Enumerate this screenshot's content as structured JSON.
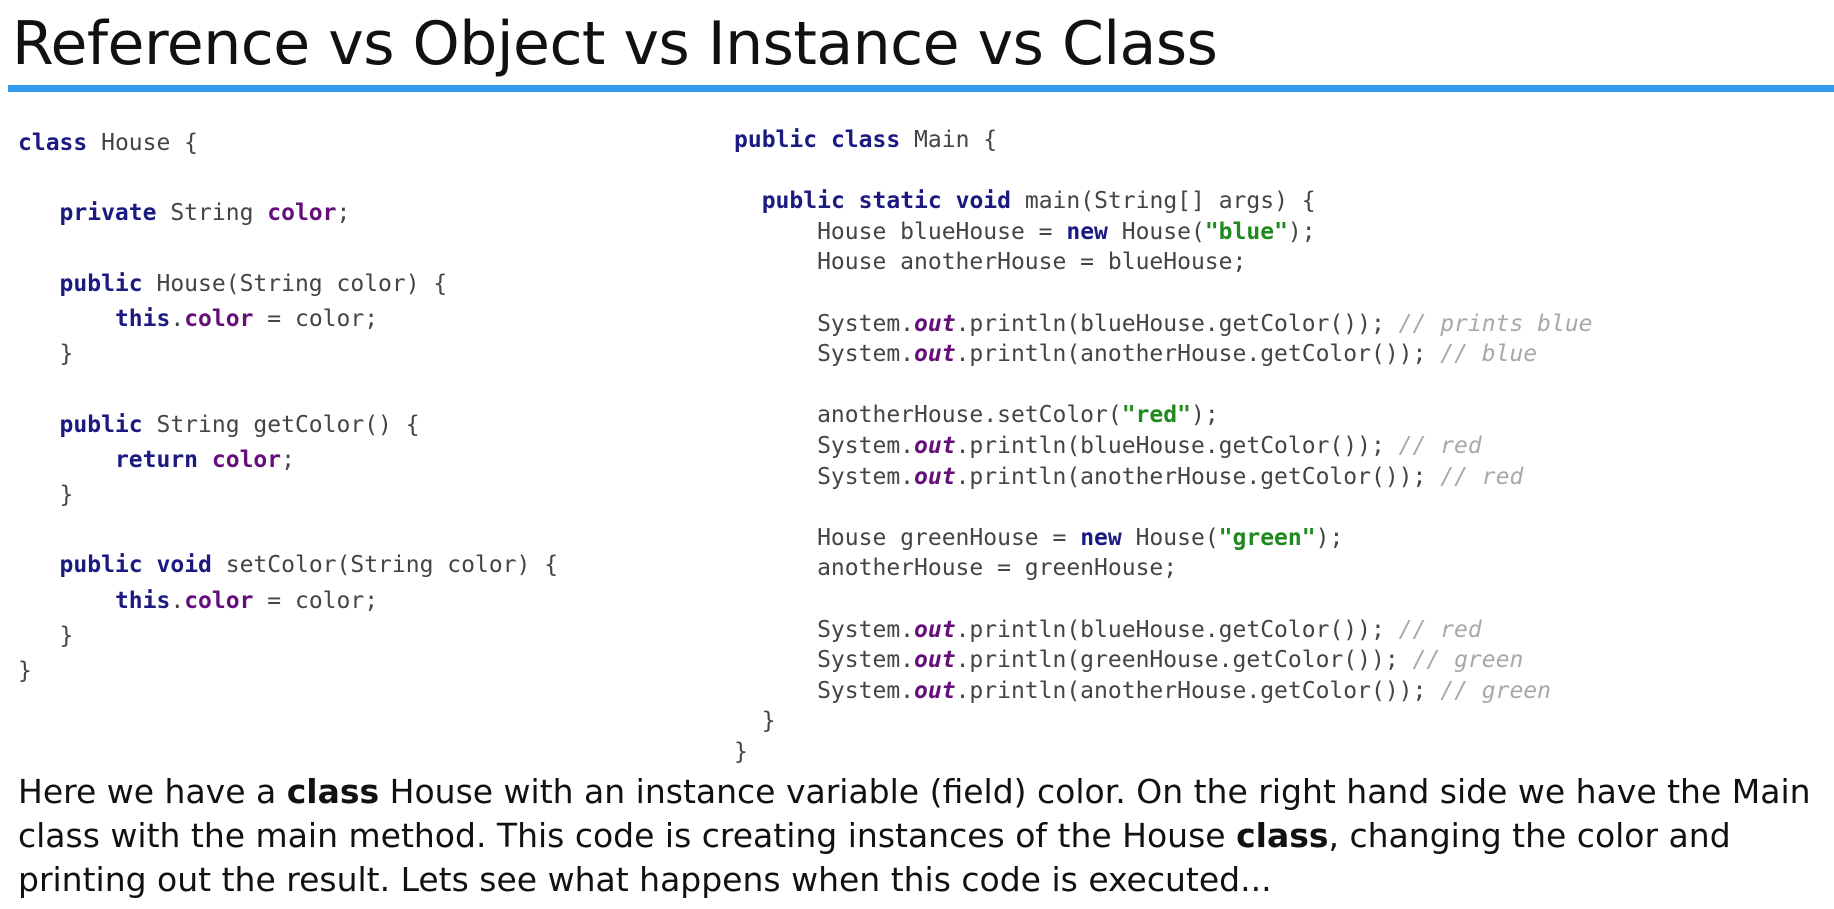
{
  "title": "Reference vs Object vs Instance vs Class",
  "left_code": [
    [
      [
        "kw",
        "class"
      ],
      [
        "pl",
        " House {"
      ]
    ],
    [],
    [
      [
        "pl",
        "   "
      ],
      [
        "kw",
        "private"
      ],
      [
        "pl",
        " String "
      ],
      [
        "fld",
        "color"
      ],
      [
        "pl",
        ";"
      ]
    ],
    [],
    [
      [
        "pl",
        "   "
      ],
      [
        "kw",
        "public"
      ],
      [
        "pl",
        " House(String color) {"
      ]
    ],
    [
      [
        "pl",
        "       "
      ],
      [
        "kw",
        "this"
      ],
      [
        "pl",
        "."
      ],
      [
        "fld",
        "color"
      ],
      [
        "pl",
        " = color;"
      ]
    ],
    [
      [
        "pl",
        "   }"
      ]
    ],
    [],
    [
      [
        "pl",
        "   "
      ],
      [
        "kw",
        "public"
      ],
      [
        "pl",
        " String getColor() {"
      ]
    ],
    [
      [
        "pl",
        "       "
      ],
      [
        "kw",
        "return"
      ],
      [
        "pl",
        " "
      ],
      [
        "fld",
        "color"
      ],
      [
        "pl",
        ";"
      ]
    ],
    [
      [
        "pl",
        "   }"
      ]
    ],
    [],
    [
      [
        "pl",
        "   "
      ],
      [
        "kw",
        "public"
      ],
      [
        "pl",
        " "
      ],
      [
        "kw",
        "void"
      ],
      [
        "pl",
        " setColor(String color) {"
      ]
    ],
    [
      [
        "pl",
        "       "
      ],
      [
        "kw",
        "this"
      ],
      [
        "pl",
        "."
      ],
      [
        "fld",
        "color"
      ],
      [
        "pl",
        " = color;"
      ]
    ],
    [
      [
        "pl",
        "   }"
      ]
    ],
    [
      [
        "pl",
        "}"
      ]
    ]
  ],
  "right_code": [
    [
      [
        "kw",
        "public"
      ],
      [
        "pl",
        " "
      ],
      [
        "kw",
        "class"
      ],
      [
        "pl",
        " Main {"
      ]
    ],
    [],
    [
      [
        "pl",
        "  "
      ],
      [
        "kw",
        "public"
      ],
      [
        "pl",
        " "
      ],
      [
        "kw",
        "static"
      ],
      [
        "pl",
        " "
      ],
      [
        "kw",
        "void"
      ],
      [
        "pl",
        " main(String[] args) {"
      ]
    ],
    [
      [
        "pl",
        "      House blueHouse = "
      ],
      [
        "kw",
        "new"
      ],
      [
        "pl",
        " House("
      ],
      [
        "str",
        "\"blue\""
      ],
      [
        "pl",
        ");"
      ]
    ],
    [
      [
        "pl",
        "      House anotherHouse = blueHouse;"
      ]
    ],
    [],
    [
      [
        "pl",
        "      System."
      ],
      [
        "out",
        "out"
      ],
      [
        "pl",
        ".println(blueHouse.getColor()); "
      ],
      [
        "cmt",
        "// prints blue"
      ]
    ],
    [
      [
        "pl",
        "      System."
      ],
      [
        "out",
        "out"
      ],
      [
        "pl",
        ".println(anotherHouse.getColor()); "
      ],
      [
        "cmt",
        "// blue"
      ]
    ],
    [],
    [
      [
        "pl",
        "      anotherHouse.setColor("
      ],
      [
        "str",
        "\"red\""
      ],
      [
        "pl",
        ");"
      ]
    ],
    [
      [
        "pl",
        "      System."
      ],
      [
        "out",
        "out"
      ],
      [
        "pl",
        ".println(blueHouse.getColor()); "
      ],
      [
        "cmt",
        "// red"
      ]
    ],
    [
      [
        "pl",
        "      System."
      ],
      [
        "out",
        "out"
      ],
      [
        "pl",
        ".println(anotherHouse.getColor()); "
      ],
      [
        "cmt",
        "// red"
      ]
    ],
    [],
    [
      [
        "pl",
        "      House greenHouse = "
      ],
      [
        "kw",
        "new"
      ],
      [
        "pl",
        " House("
      ],
      [
        "str",
        "\"green\""
      ],
      [
        "pl",
        ");"
      ]
    ],
    [
      [
        "pl",
        "      anotherHouse = greenHouse;"
      ]
    ],
    [],
    [
      [
        "pl",
        "      System."
      ],
      [
        "out",
        "out"
      ],
      [
        "pl",
        ".println(blueHouse.getColor()); "
      ],
      [
        "cmt",
        "// red"
      ]
    ],
    [
      [
        "pl",
        "      System."
      ],
      [
        "out",
        "out"
      ],
      [
        "pl",
        ".println(greenHouse.getColor()); "
      ],
      [
        "cmt",
        "// green"
      ]
    ],
    [
      [
        "pl",
        "      System."
      ],
      [
        "out",
        "out"
      ],
      [
        "pl",
        ".println(anotherHouse.getColor()); "
      ],
      [
        "cmt",
        "// green"
      ]
    ],
    [
      [
        "pl",
        "  }"
      ]
    ],
    [
      [
        "pl",
        "}"
      ]
    ]
  ],
  "paragraph": [
    {
      "text": "Here we have a ",
      "bold": false
    },
    {
      "text": "class",
      "bold": true
    },
    {
      "text": " House with an instance variable (field) color. On the right hand side we have the Main class with the main method. This code is creating instances of the House ",
      "bold": false
    },
    {
      "text": "class",
      "bold": true
    },
    {
      "text": ", changing the color and printing out the result.  Lets see what happens when this code is executed...",
      "bold": false
    }
  ]
}
